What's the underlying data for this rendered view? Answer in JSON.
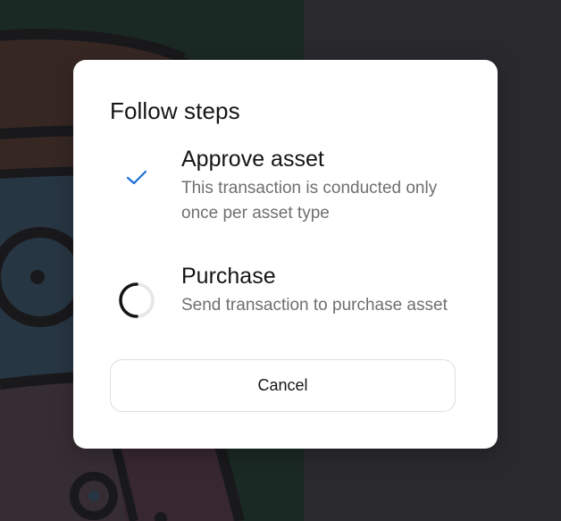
{
  "modal": {
    "title": "Follow steps",
    "steps": [
      {
        "title": "Approve asset",
        "description": "This transaction is conducted only once per asset type",
        "status": "completed",
        "icon": "checkmark-icon"
      },
      {
        "title": "Purchase",
        "description": "Send transaction to purchase asset",
        "status": "in-progress",
        "icon": "spinner-icon"
      }
    ],
    "cancel_label": "Cancel"
  },
  "colors": {
    "accent": "#1a6fd6",
    "text_primary": "#151515",
    "text_secondary": "#6f6f6f",
    "backdrop": "#2c2b30",
    "modal_bg": "#ffffff"
  }
}
